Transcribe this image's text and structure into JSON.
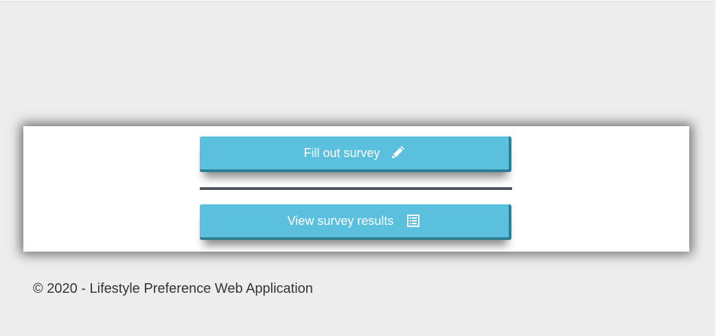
{
  "actions": {
    "fill_label": "Fill out survey",
    "fill_icon": "pencil-icon",
    "view_label": "View survey results",
    "view_icon": "list-icon"
  },
  "footer": {
    "text": "© 2020 - Lifestyle Preference Web Application"
  },
  "colors": {
    "background": "#ededed",
    "panel": "#ffffff",
    "button": "#5bc0de",
    "button_edge": "#2f7f94",
    "divider": "#4d5359",
    "footer_text": "#333333"
  }
}
